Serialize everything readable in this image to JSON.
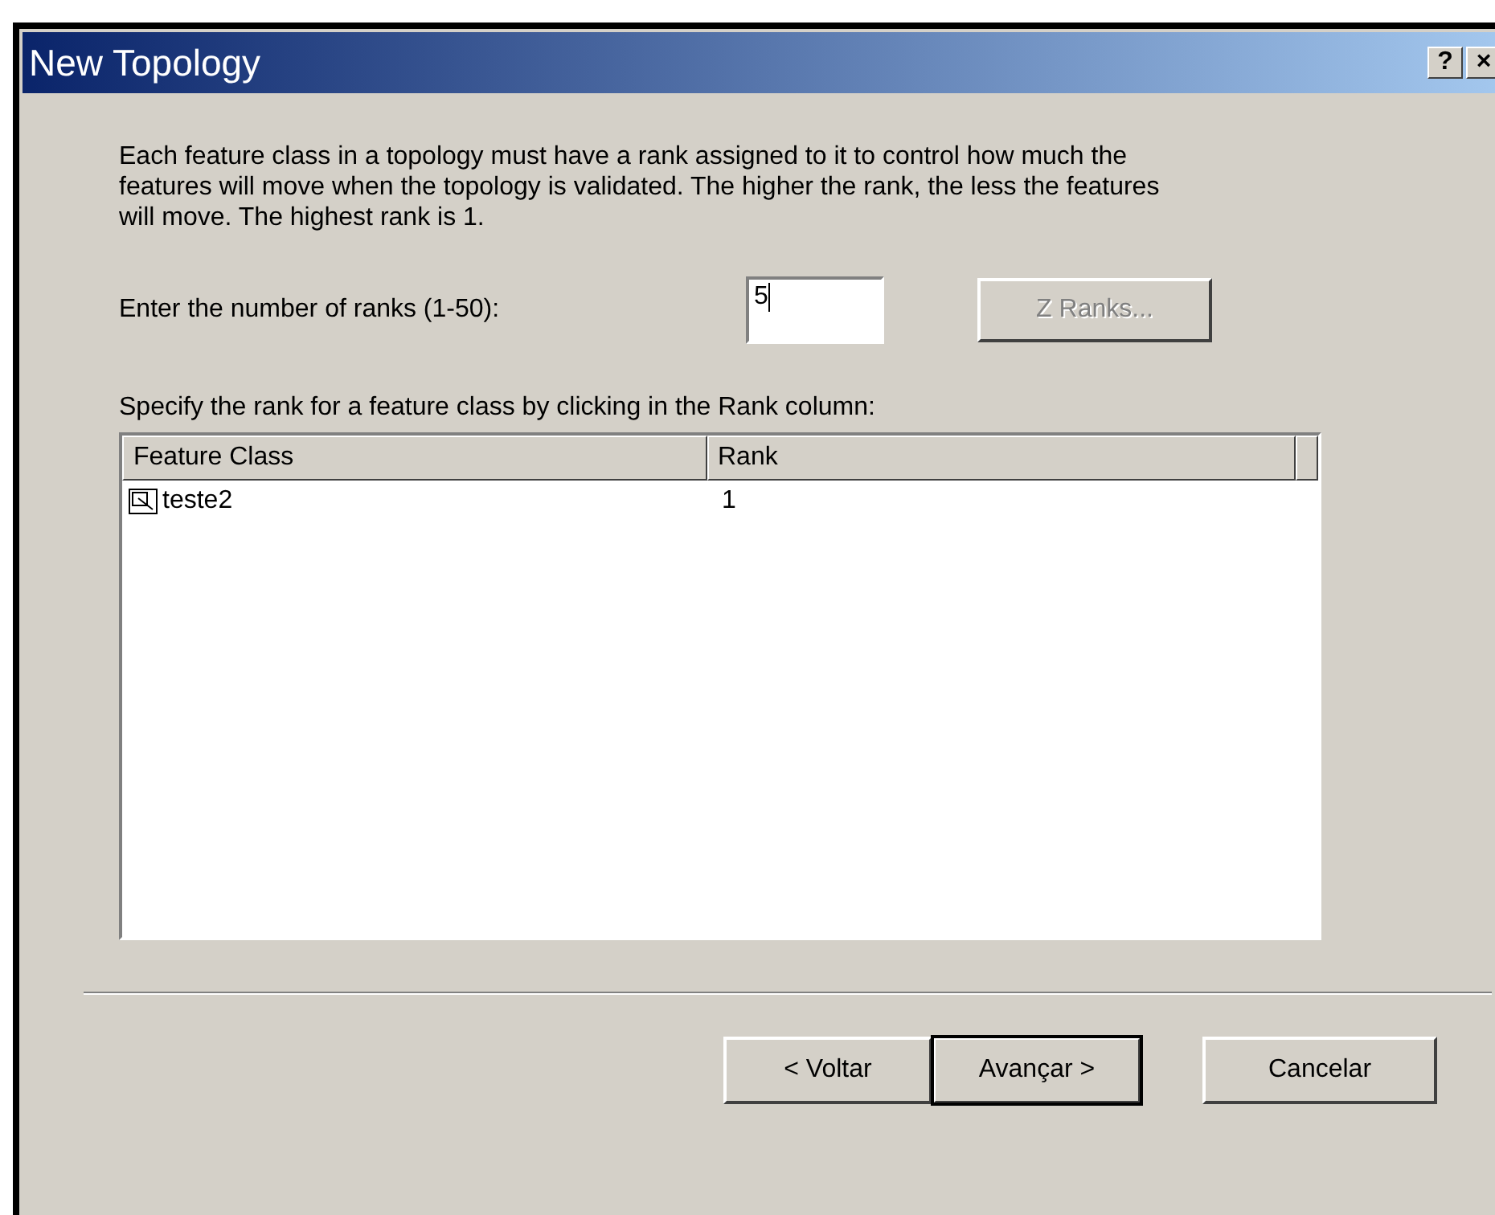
{
  "window": {
    "title": "New Topology",
    "title_buttons": [
      "?",
      "×"
    ]
  },
  "description": "Each feature class in a topology must have a rank assigned to it to control how much the features will move when the topology is validated. The higher the rank, the less the features will move. The highest rank is 1.",
  "ranks_field": {
    "label": "Enter the number of ranks  (1-50):",
    "value": "5"
  },
  "z_ranks_button": {
    "label": "Z Ranks...",
    "disabled": true
  },
  "list_label": "Specify the rank for a feature class by clicking in the Rank column:",
  "table": {
    "columns": [
      "Feature Class",
      "Rank"
    ],
    "rows": [
      {
        "feature_class": "teste2",
        "rank": "1"
      }
    ]
  },
  "buttons": [
    {
      "label": "< Voltar",
      "default": false
    },
    {
      "label": "Avançar >",
      "default": true
    },
    {
      "label": "Cancelar",
      "default": false
    }
  ]
}
